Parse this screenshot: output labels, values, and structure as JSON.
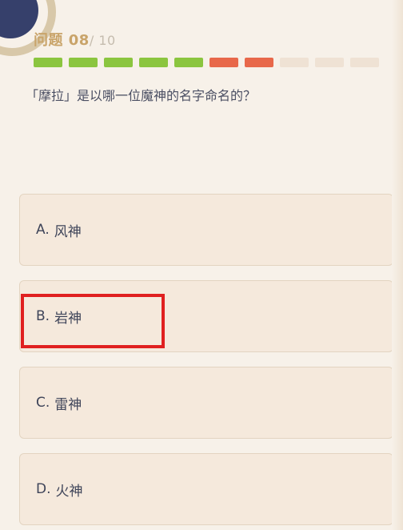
{
  "quiz": {
    "question_prefix": "问题 ",
    "question_number": "08",
    "question_total": "/ 10",
    "question_text": "「摩拉」是以哪一位魔神的名字命名的？",
    "progress": [
      "correct",
      "correct",
      "correct",
      "correct",
      "correct",
      "wrong",
      "wrong",
      "pending",
      "pending",
      "pending"
    ],
    "options": [
      {
        "letter": "A.",
        "label": "风神"
      },
      {
        "letter": "B.",
        "label": "岩神"
      },
      {
        "letter": "C.",
        "label": "雷神"
      },
      {
        "letter": "D.",
        "label": "火神"
      }
    ],
    "highlighted_option": "B"
  },
  "colors": {
    "correct": "#8bc53f",
    "wrong": "#e8684a",
    "pending": "#efe2d4",
    "highlight": "#e02020"
  }
}
